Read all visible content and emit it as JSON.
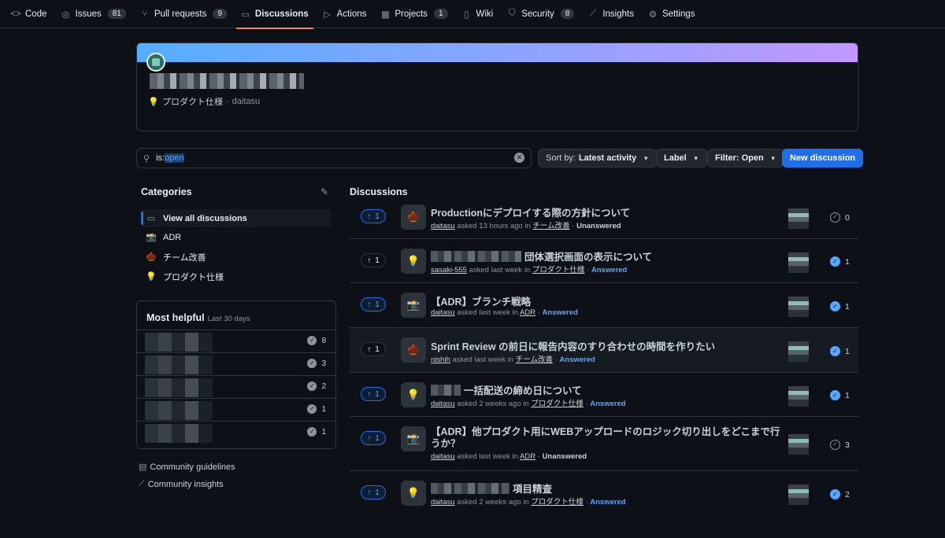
{
  "nav": {
    "tabs": [
      {
        "label": "Code",
        "count": ""
      },
      {
        "label": "Issues",
        "count": "81"
      },
      {
        "label": "Pull requests",
        "count": "9"
      },
      {
        "label": "Discussions",
        "count": ""
      },
      {
        "label": "Actions",
        "count": ""
      },
      {
        "label": "Projects",
        "count": "1"
      },
      {
        "label": "Wiki",
        "count": ""
      },
      {
        "label": "Security",
        "count": "8"
      },
      {
        "label": "Insights",
        "count": ""
      },
      {
        "label": "Settings",
        "count": ""
      }
    ]
  },
  "header": {
    "category": "プロダクト仕様",
    "separator": "·",
    "author": "daitasu"
  },
  "search": {
    "prefix": "is:",
    "value": "open"
  },
  "toolbar": {
    "sort_prefix": "Sort by:",
    "sort_value": "Latest activity",
    "label": "Label",
    "filter": "Filter: Open",
    "new_discussion": "New discussion"
  },
  "sidebar": {
    "title": "Categories",
    "items": [
      {
        "label": "View all discussions",
        "icon": "discussion-icon"
      },
      {
        "label": "ADR",
        "icon": "adr-emoji-icon"
      },
      {
        "label": "チーム改善",
        "icon": "improvement-emoji-icon"
      },
      {
        "label": "プロダクト仕様",
        "icon": "bulb-icon"
      }
    ],
    "helpful": {
      "title": "Most helpful",
      "period": "Last 30 days",
      "scores": [
        "8",
        "3",
        "2",
        "1",
        "1"
      ]
    },
    "links": {
      "guidelines": "Community guidelines",
      "insights": "Community insights"
    }
  },
  "main": {
    "title": "Discussions",
    "discussions": [
      {
        "votes": "1",
        "title": "Productionにデプロイする際の方針について",
        "user": "daitasu",
        "when": "asked 13 hours ago in",
        "category": "チーム改善",
        "status": "Unanswered",
        "comments": "0"
      },
      {
        "votes": "1",
        "title": "団体選択画面の表示について",
        "user": "sasaki-555",
        "when": "asked last week in",
        "category": "プロダクト仕様",
        "status": "Answered",
        "comments": "1"
      },
      {
        "votes": "1",
        "title": "【ADR】ブランチ戦略",
        "user": "daitasu",
        "when": "asked last week in",
        "category": "ADR",
        "status": "Answered",
        "comments": "1"
      },
      {
        "votes": "1",
        "title": "Sprint Review の前日に報告内容のすり合わせの時間を作りたい",
        "user": "nishih",
        "when": "asked last week in",
        "category": "チーム改善",
        "status": "Answered",
        "comments": "1"
      },
      {
        "votes": "1",
        "title": "一括配送の締め日について",
        "user": "daitasu",
        "when": "asked 2 weeks ago in",
        "category": "プロダクト仕様",
        "status": "Answered",
        "comments": "1"
      },
      {
        "votes": "1",
        "title": "【ADR】他プロダクト用にWEBアップロードのロジック切り出しをどこまで行うか？",
        "user": "daitasu",
        "when": "asked last week in",
        "category": "ADR",
        "status": "Unanswered",
        "comments": "3"
      },
      {
        "votes": "1",
        "title": "項目精査",
        "user": "daitasu",
        "when": "asked 2 weeks ago in",
        "category": "プロダクト仕様",
        "status": "Answered",
        "comments": "2"
      }
    ]
  },
  "colors": {
    "accent": "#1f6feb",
    "active_tab_underline": "#f78166",
    "answered": "#58a6ff",
    "background": "#0d1117"
  }
}
